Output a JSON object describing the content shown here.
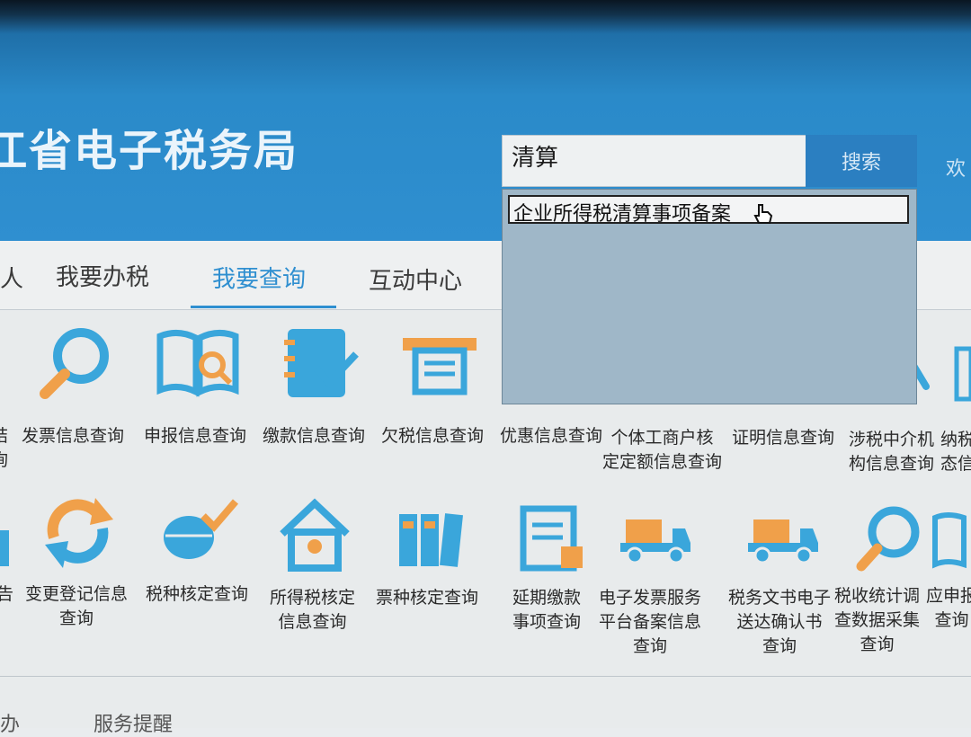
{
  "header": {
    "title": "江省电子税务局"
  },
  "search": {
    "value": "清算",
    "button": "搜索",
    "suggestion": "企业所得税清算事项备案"
  },
  "welcome": "欢",
  "nav": {
    "edge": "人",
    "items": [
      "我要办税",
      "我要查询",
      "互动中心"
    ]
  },
  "row1": [
    {
      "l1": "结",
      "l2": "询"
    },
    {
      "l1": "发票信息查询"
    },
    {
      "l1": "申报信息查询"
    },
    {
      "l1": "缴款信息查询"
    },
    {
      "l1": "欠税信息查询"
    },
    {
      "l1": "优惠信息查询"
    },
    {
      "l1": "个体工商户核",
      "l2": "定定额信息查询"
    },
    {
      "l1": "证明信息查询"
    },
    {
      "l1": "涉税中介机",
      "l2": "构信息查询"
    },
    {
      "l1": "纳税",
      "l2": "态信"
    }
  ],
  "row2": [
    {
      "l1": "告"
    },
    {
      "l1": "变更登记信息",
      "l2": "查询"
    },
    {
      "l1": "税种核定查询"
    },
    {
      "l1": "所得税核定",
      "l2": "信息查询"
    },
    {
      "l1": "票种核定查询"
    },
    {
      "l1": "延期缴款",
      "l2": "事项查询"
    },
    {
      "l1": "电子发票服务",
      "l2": "平台备案信息",
      "l3": "查询"
    },
    {
      "l1": "税务文书电子",
      "l2": "送达确认书",
      "l3": "查询"
    },
    {
      "l1": "税收统计调",
      "l2": "查数据采集",
      "l3": "查询"
    },
    {
      "l1": "应申报",
      "l2": "查询"
    }
  ],
  "footer": {
    "tab1": "办",
    "tab2": "服务提醒"
  },
  "colors": {
    "accent": "#2f8fd0",
    "icon_blue": "#3aa6db",
    "icon_orange": "#f0a04a"
  }
}
